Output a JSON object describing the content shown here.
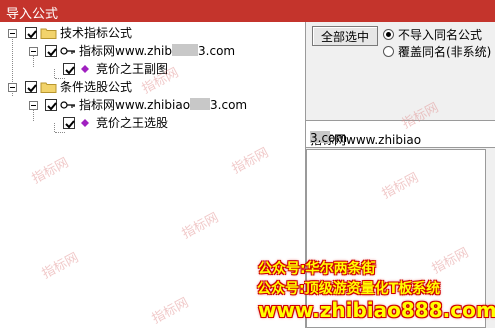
{
  "window": {
    "title": "导入公式"
  },
  "tree": {
    "groups": [
      {
        "label": "技术指标公式",
        "checked": true,
        "site_prefix": "指标网www.zhib",
        "site_suffix": "3.com",
        "formula": "竞价之王副图"
      },
      {
        "label": "条件选股公式",
        "checked": true,
        "site_prefix": "指标网www.zhibiao",
        "site_suffix": "3.com",
        "formula": "竞价之王选股"
      }
    ]
  },
  "panel": {
    "select_all_label": "全部选中",
    "options": [
      {
        "label": "不导入同名公式",
        "selected": true
      },
      {
        "label": "覆盖同名(非系统)",
        "selected": false
      }
    ],
    "info_prefix": "指标网www.zhibiao",
    "info_suffix": "3.com"
  },
  "overlay": {
    "watermark": "指标网",
    "line1": "公众号:华尔两条街",
    "line2": "公众号:顶级游资量化T板系统",
    "line3": "www.zhibiao888.com"
  },
  "colors": {
    "titlebar": "#c4342c",
    "folder": "#f2d36b",
    "formula_icon": "#a020c0",
    "banner_fill": "#ffff00",
    "banner_outline": "#d00000"
  }
}
